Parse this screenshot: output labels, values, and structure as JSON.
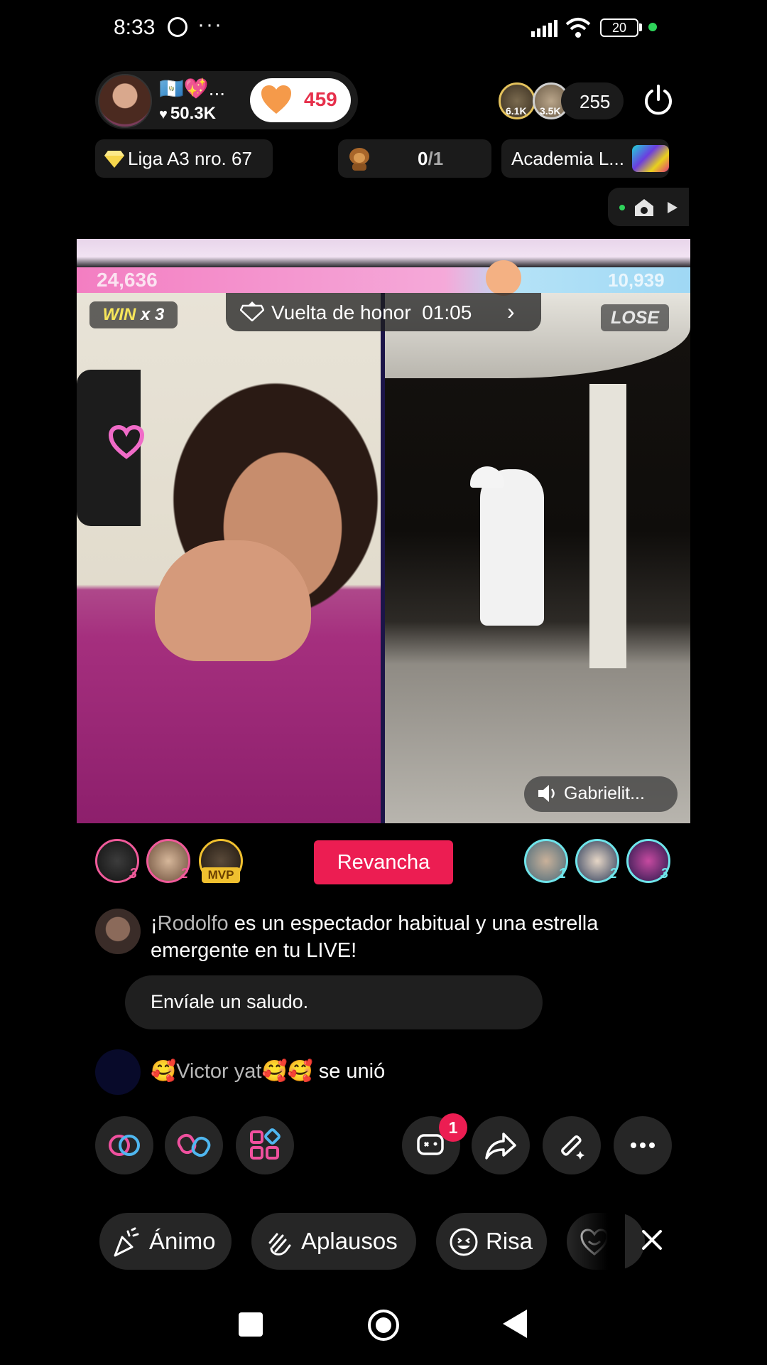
{
  "status_bar": {
    "time": "8:33",
    "more": "···",
    "battery": "20"
  },
  "host": {
    "flags": "🇬🇹💖...",
    "likes": "50.3K",
    "gift_count": "459"
  },
  "viewers": {
    "top1": "6.1K",
    "top2": "3.5K",
    "count": "255"
  },
  "chips": {
    "league": "Liga A3 nro. 67",
    "goal_done": "0",
    "goal_total": "/1",
    "academy": "Academia L..."
  },
  "battle": {
    "left_score": "24,636",
    "right_score": "10,939",
    "win_label": "WIN",
    "win_multiplier": "x 3",
    "lose_label": "LOSE",
    "honor_lap": "Vuelta de honor",
    "honor_timer": "01:05",
    "opponent_audio": "Gabrielit..."
  },
  "gifters_left": [
    {
      "rank": "3"
    },
    {
      "rank": "2"
    },
    {
      "badge": "MVP"
    }
  ],
  "gifters_right": [
    {
      "rank": "1"
    },
    {
      "rank": "2"
    },
    {
      "rank": "3"
    }
  ],
  "rematch_label": "Revancha",
  "chat": {
    "msg_prefix": "¡",
    "msg_user": "Rodolfo",
    "msg_text": " es un espectador habitual y una estrella emergente en tu LIVE!",
    "greet_label": "Envíale un saludo.",
    "join_user": "🥰Victor yat🥰🥰",
    "join_text": " se unió"
  },
  "actions": {
    "notification_count": "1"
  },
  "reactions": [
    {
      "label": "Ánimo"
    },
    {
      "label": "Aplausos"
    },
    {
      "label": "Risa"
    }
  ],
  "colors": {
    "accent": "#ec1d52",
    "score_left": "#f37ec2",
    "score_right": "#9fd8f4",
    "mvp": "#f0c02f"
  }
}
